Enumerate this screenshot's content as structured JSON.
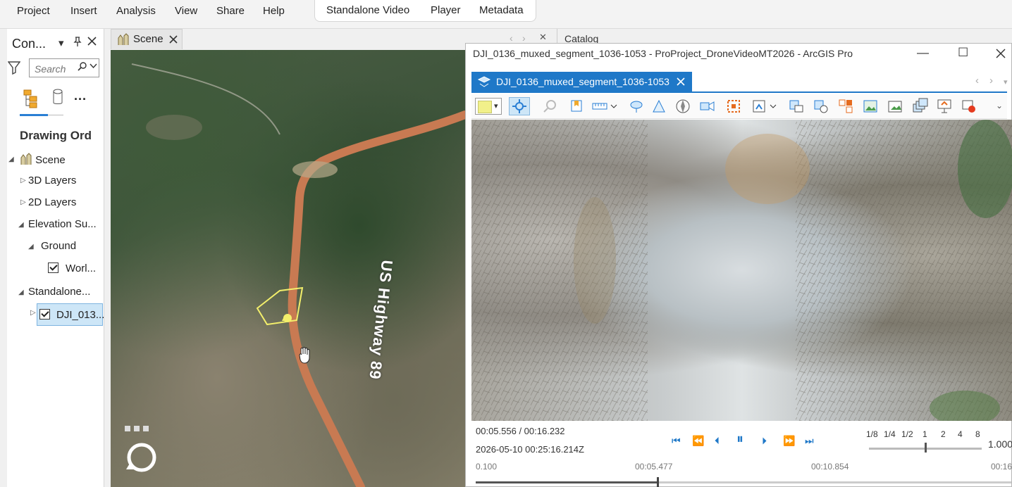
{
  "menu": [
    "Project",
    "Insert",
    "Analysis",
    "View",
    "Share",
    "Help"
  ],
  "context_tabs": [
    "Standalone Video",
    "Player",
    "Metadata"
  ],
  "contents": {
    "title": "Con...",
    "search_placeholder": "Search",
    "heading": "Drawing Ord",
    "tree": {
      "scene": "Scene",
      "layers3d": "3D Layers",
      "layers2d": "2D Layers",
      "elevation": "Elevation Su...",
      "ground": "Ground",
      "world": "Worl...",
      "standalone": "Standalone...",
      "dji": "DJI_013..."
    }
  },
  "scene": {
    "tab_label": "Scene",
    "road_label": "US Highway 89"
  },
  "catalog_title": "Catalog",
  "video": {
    "window_title": "DJI_0136_muxed_segment_1036-1053 - ProProject_DroneVideoMT2026 - ArcGIS Pro",
    "tab_label": "DJI_0136_muxed_segment_1036-1053",
    "time": "00:05.556 / 00:16.232",
    "timestamp": "2026-05-10 00:25:16.214Z",
    "rate_labels": [
      "1/8",
      "1/4",
      "1/2",
      "1",
      "2",
      "4",
      "8"
    ],
    "rate_value": "1.000",
    "rate_position": 0.5,
    "timeline_labels": [
      "0.100",
      "00:05.477",
      "00:10.854",
      "00:16"
    ],
    "timeline_progress": 0.34,
    "colors": {
      "accent": "#1f78c8",
      "frame_symbol": "#f1f08a"
    }
  }
}
